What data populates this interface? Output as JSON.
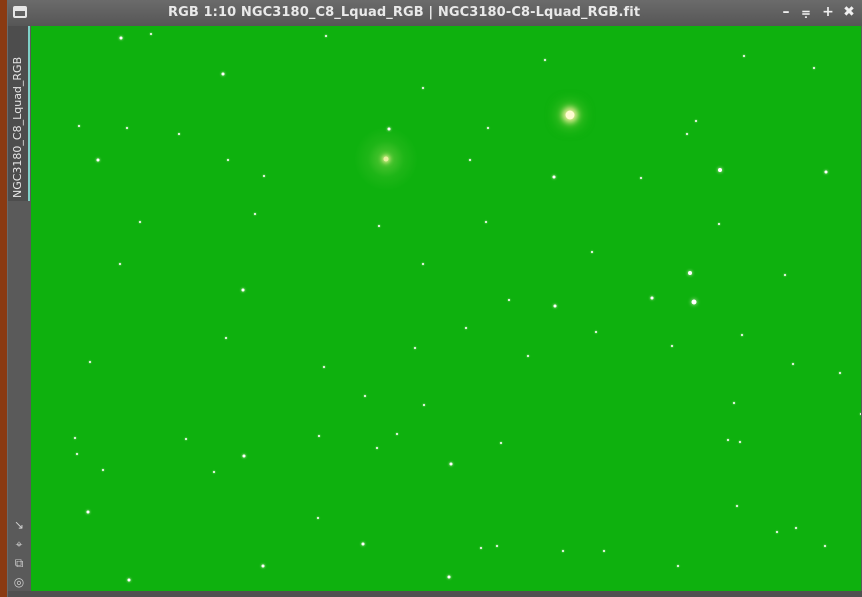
{
  "window": {
    "title": "RGB 1:10 NGC3180_C8_Lquad_RGB | NGC3180-C8-Lquad_RGB.fit",
    "buttons": {
      "minimize": "–",
      "restore": "⩦",
      "maximize": "+",
      "close": "✖"
    }
  },
  "side_tab": {
    "label": "NGC3180_C8_Lquad_RGB"
  },
  "side_tools": [
    {
      "name": "resize-arrow-icon",
      "glyph": "↘"
    },
    {
      "name": "fit-view-icon",
      "glyph": "⌖"
    },
    {
      "name": "clone-view-icon",
      "glyph": "⧉"
    },
    {
      "name": "target-icon",
      "glyph": "◎"
    }
  ],
  "colors": {
    "image_background": "#0eb10e",
    "tab_accent": "#7fd0c8",
    "desktop_accent": "#8a3a12"
  }
}
